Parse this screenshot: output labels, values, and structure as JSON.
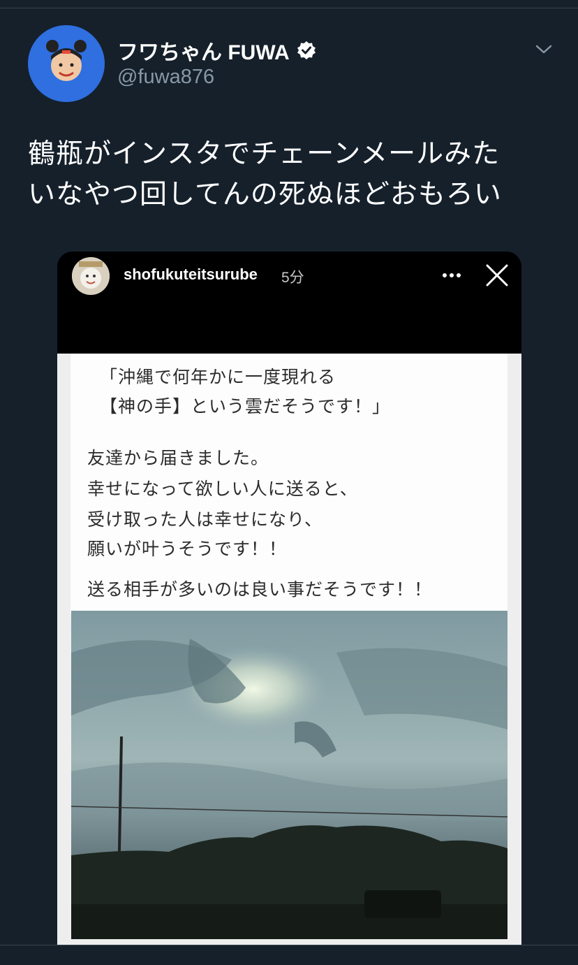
{
  "tweet": {
    "author_name": "フワちゃん FUWA",
    "handle": "@fuwa876",
    "text_lines": [
      "鶴瓶がインスタでチェーンメールみた",
      "いなやつ回してんの死ぬほどおもろい"
    ]
  },
  "story": {
    "username": "shofukuteitsurube",
    "time": "5分",
    "text_lines": [
      "「沖縄で何年かに一度現れる",
      "【神の手】という雲だそうです！」",
      "友達から届きました。",
      "幸せになって欲しい人に送ると、",
      "受け取った人は幸せになり、",
      "願いが叶うそうです！！",
      "送る相手が多いのは良い事だそうです！！"
    ]
  },
  "icons": [
    "verified-badge-icon",
    "chevron-down-icon",
    "more-dots-icon",
    "close-icon"
  ],
  "colors": {
    "background": "#15202b",
    "secondary_text": "#8899a6",
    "avatar_bg": "#2f6fe0"
  }
}
